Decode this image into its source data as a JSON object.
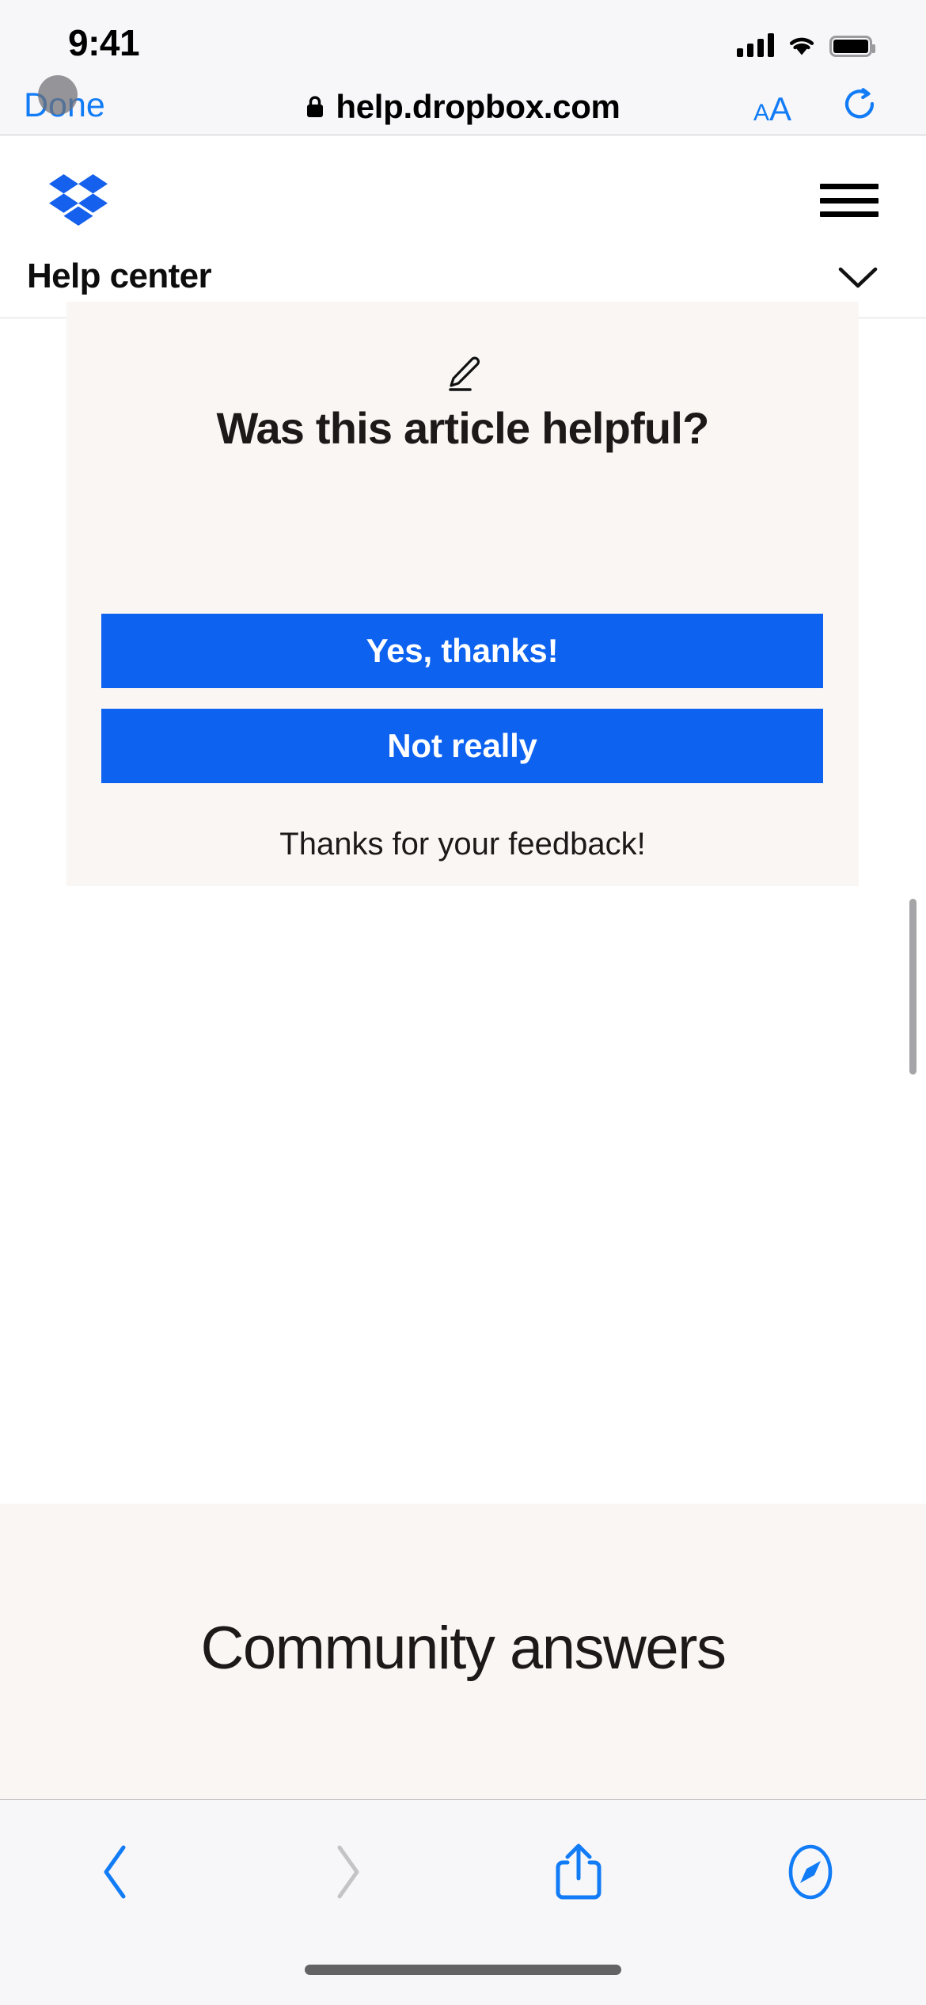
{
  "status_bar": {
    "time": "9:41",
    "icons": [
      "cellular-signal-icon",
      "wifi-icon",
      "battery-icon"
    ]
  },
  "browser": {
    "done_label": "Done",
    "url": "help.dropbox.com",
    "lock_icon": "lock-icon",
    "text_size_small": "A",
    "text_size_large": "A",
    "reload_icon": "reload-icon",
    "touch_indicator": "touch-indicator"
  },
  "site_header": {
    "logo": "dropbox-logo",
    "menu_icon": "hamburger-menu-icon"
  },
  "help_bar": {
    "title": "Help center",
    "chevron_icon": "chevron-down-icon"
  },
  "feedback": {
    "icon": "pencil-edit-icon",
    "heading": "Was this article helpful?",
    "yes_label": "Yes, thanks!",
    "no_label": "Not really",
    "thanks_message": "Thanks for your feedback!",
    "button_color": "#0d62f0",
    "card_background": "#faf6f4"
  },
  "community": {
    "title": "Community answers",
    "background": "#faf6f4"
  },
  "toolbar": {
    "back_icon": "back-chevron-icon",
    "forward_icon": "forward-chevron-icon",
    "share_icon": "share-icon",
    "tabs_icon": "safari-compass-icon",
    "active_color": "#127cf7",
    "disabled_color": "#bdbdc2"
  }
}
